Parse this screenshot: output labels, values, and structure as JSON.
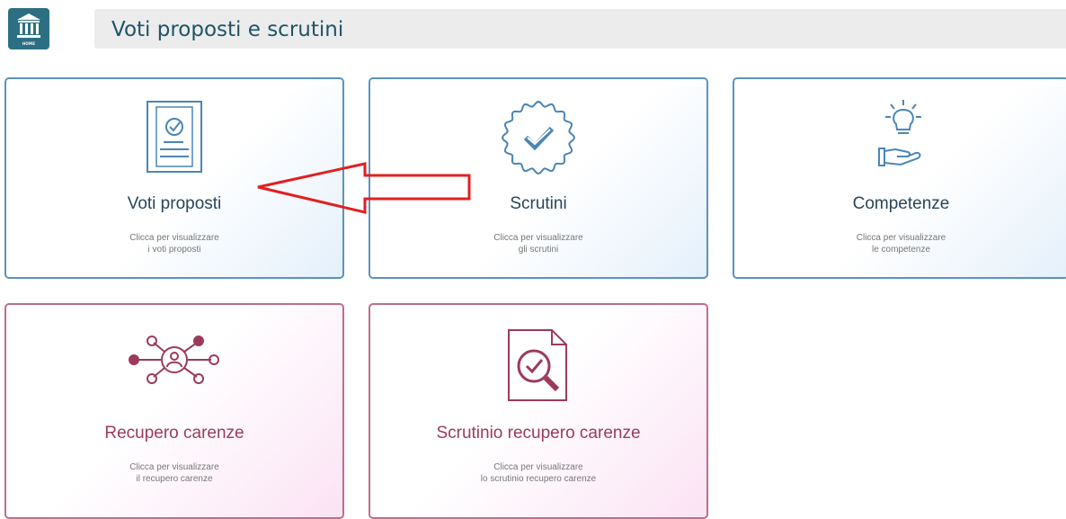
{
  "header": {
    "home_label": "HOME",
    "title": "Voti proposti e scrutini"
  },
  "cards": [
    {
      "title": "Voti proposti",
      "subtitle_line1": "Clicca per visualizzare",
      "subtitle_line2": "i voti proposti",
      "icon": "document-check-icon"
    },
    {
      "title": "Scrutini",
      "subtitle_line1": "Clicca per visualizzare",
      "subtitle_line2": "gli scrutini",
      "icon": "badge-check-icon"
    },
    {
      "title": "Competenze",
      "subtitle_line1": "Clicca per visualizzare",
      "subtitle_line2": "le competenze",
      "icon": "hand-lightbulb-icon"
    },
    {
      "title": "Recupero carenze",
      "subtitle_line1": "Clicca per visualizzare",
      "subtitle_line2": "il recupero carenze",
      "icon": "network-person-icon"
    },
    {
      "title": "Scrutinio recupero carenze",
      "subtitle_line1": "Clicca per visualizzare",
      "subtitle_line2": "lo scrutinio recupero carenze",
      "icon": "document-search-icon"
    }
  ],
  "colors": {
    "blue_border": "#5b93bf",
    "pink_border": "#c06d8c",
    "blue_icon": "#4a86b5",
    "pink_icon": "#9c3a5d",
    "annotation_arrow": "#e02020"
  }
}
